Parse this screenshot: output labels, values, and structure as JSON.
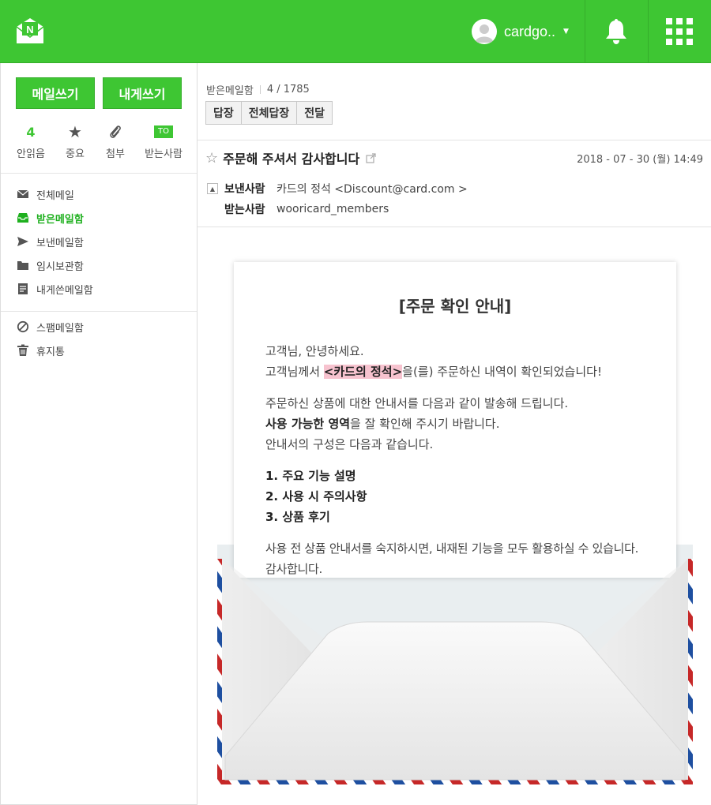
{
  "header": {
    "username": "cardgo..",
    "accent_color": "#3ec633",
    "logo_letter": "N"
  },
  "sidebar": {
    "compose_label": "메일쓰기",
    "self_compose_label": "내게쓰기",
    "stats": [
      {
        "value": "4",
        "label": "안읽음"
      },
      {
        "icon": "star-icon",
        "label": "중요"
      },
      {
        "icon": "paperclip-icon",
        "label": "첨부"
      },
      {
        "badge": "TO",
        "label": "받는사람"
      }
    ],
    "folders": [
      {
        "label": "전체메일",
        "icon": "envelope-icon"
      },
      {
        "label": "받은메일함",
        "icon": "inbox-icon",
        "active": true
      },
      {
        "label": "보낸메일함",
        "icon": "send-icon"
      },
      {
        "label": "임시보관함",
        "icon": "folder-icon"
      },
      {
        "label": "내게쓴메일함",
        "icon": "note-icon"
      }
    ],
    "folders2": [
      {
        "label": "스팸메일함",
        "icon": "block-icon"
      },
      {
        "label": "휴지통",
        "icon": "trash-icon"
      }
    ]
  },
  "mail": {
    "folder_name": "받은메일함",
    "position": "4 / 1785",
    "actions": [
      "답장",
      "전체답장",
      "전달"
    ],
    "subject": "주문해 주셔서 감사합니다",
    "date": "2018 - 07 - 30 (월) 14:49",
    "from_label": "보낸사람",
    "from_value": "카드의 정석 <Discount@card.com >",
    "to_label": "받는사람",
    "to_value": "wooricard_members"
  },
  "letter": {
    "title": "[주문 확인 안내]",
    "greeting": "고객님, 안녕하세요.",
    "line2_pre": "고객님께서 ",
    "line2_highlight": "<카드의 정석>",
    "line2_post": "을(를) 주문하신 내역이 확인되었습니다!",
    "para2_line1": "주문하신 상품에 대한 안내서를 다음과 같이 발송해 드립니다.",
    "para2_line2_bold": "사용 가능한 영역",
    "para2_line2_rest": "을 잘 확인해 주시기 바랍니다.",
    "para2_line3": "안내서의 구성은 다음과 같습니다.",
    "list": [
      "1. 주요 기능 설명",
      "2. 사용 시 주의사항",
      "3. 상품 후기"
    ],
    "closing1": "사용 전 상품 안내서를 숙지하시면, 내재된 기능을 모두 활용하실 수 있습니다.",
    "closing2": "감사합니다."
  }
}
